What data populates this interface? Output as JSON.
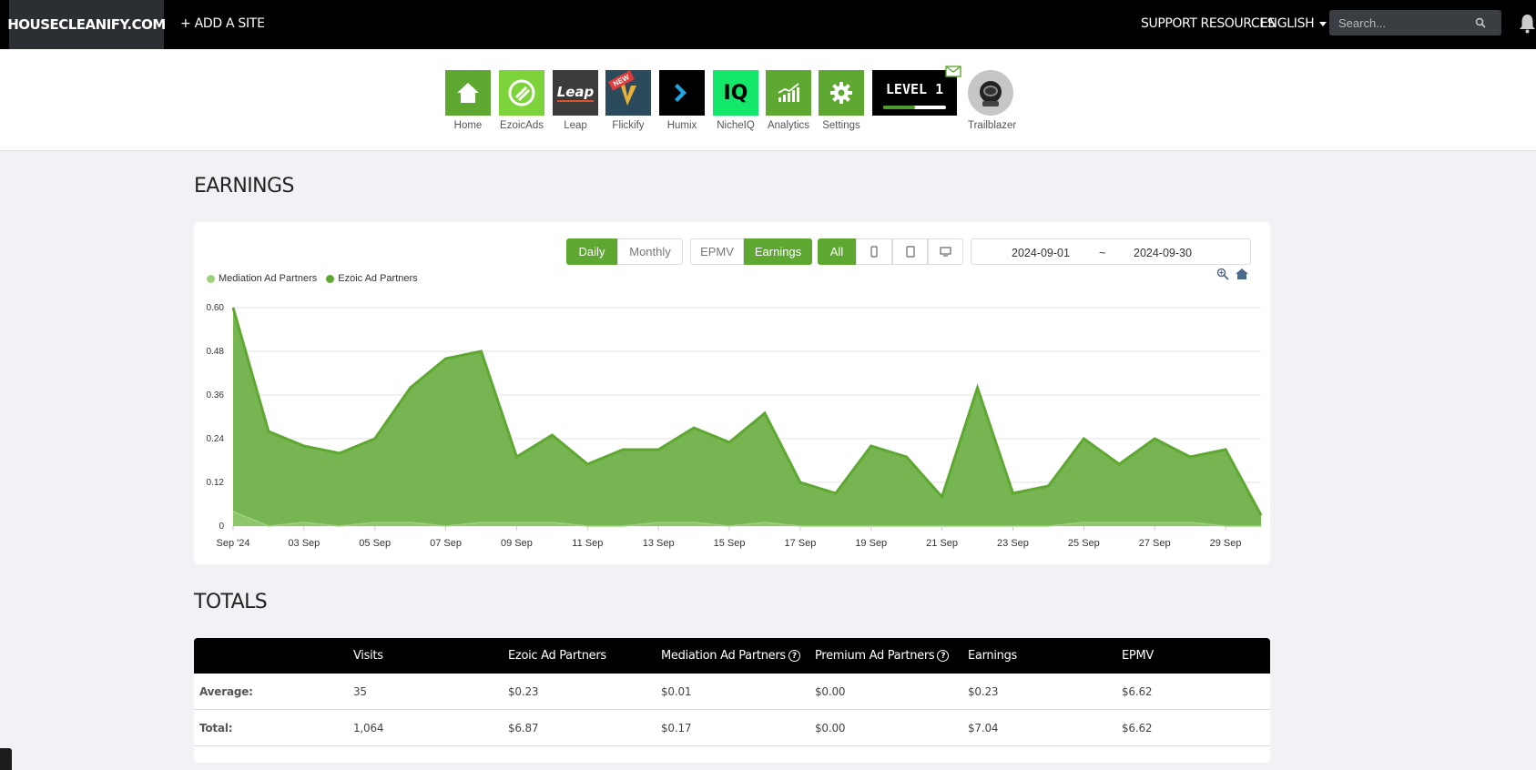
{
  "topbar": {
    "site_name": "HOUSECLEANIFY.COM",
    "add_site": "+ ADD A SITE",
    "support": "SUPPORT RESOURCES",
    "language": "ENGLISH",
    "search_placeholder": "Search..."
  },
  "apps": [
    {
      "label": "Home",
      "icon": "home-icon",
      "color": "#5ea832"
    },
    {
      "label": "EzoicAds",
      "icon": "ezoicads-icon",
      "color": "#7dd33a"
    },
    {
      "label": "Leap",
      "icon": "leap-logo",
      "color": "#3b3b3b"
    },
    {
      "label": "Flickify",
      "icon": "flickify-logo",
      "color": "#2b4a5c"
    },
    {
      "label": "Humix",
      "icon": "humix-logo",
      "color": "#000000"
    },
    {
      "label": "NicheIQ",
      "icon": "nicheiq-logo",
      "color": "#14e86a"
    },
    {
      "label": "Analytics",
      "icon": "analytics-icon",
      "color": "#5ea832"
    },
    {
      "label": "Settings",
      "icon": "gear-icon",
      "color": "#5ea832"
    }
  ],
  "app_badges": {
    "leap_text": "Leap",
    "flickify_new": "NEW",
    "nicheiq_text": "IQ"
  },
  "level": {
    "label": "LEVEL 1",
    "progress": 0.5
  },
  "trailblazer": {
    "label": "Trailblazer"
  },
  "earnings": {
    "title": "EARNINGS",
    "period_buttons": [
      "Daily",
      "Monthly"
    ],
    "metric_buttons": [
      "EPMV",
      "Earnings"
    ],
    "device_all": "All",
    "date_from": "2024-09-01",
    "date_sep": "~",
    "date_to": "2024-09-30",
    "legend": [
      "Mediation Ad Partners",
      "Ezoic Ad Partners"
    ]
  },
  "chart_data": {
    "type": "area",
    "x": [
      "2024-09-01",
      "2024-09-02",
      "2024-09-03",
      "2024-09-04",
      "2024-09-05",
      "2024-09-06",
      "2024-09-07",
      "2024-09-08",
      "2024-09-09",
      "2024-09-10",
      "2024-09-11",
      "2024-09-12",
      "2024-09-13",
      "2024-09-14",
      "2024-09-15",
      "2024-09-16",
      "2024-09-17",
      "2024-09-18",
      "2024-09-19",
      "2024-09-20",
      "2024-09-21",
      "2024-09-22",
      "2024-09-23",
      "2024-09-24",
      "2024-09-25",
      "2024-09-26",
      "2024-09-27",
      "2024-09-28",
      "2024-09-29",
      "2024-09-30"
    ],
    "x_tick_labels": [
      "Sep '24",
      "03 Sep",
      "05 Sep",
      "07 Sep",
      "09 Sep",
      "11 Sep",
      "13 Sep",
      "15 Sep",
      "17 Sep",
      "19 Sep",
      "21 Sep",
      "23 Sep",
      "25 Sep",
      "27 Sep",
      "29 Sep"
    ],
    "y_ticks": [
      "0",
      "0.12",
      "0.24",
      "0.36",
      "0.48",
      "0.60"
    ],
    "ylim": [
      0,
      0.6
    ],
    "series": [
      {
        "name": "Ezoic Ad Partners",
        "color": "#5ea832",
        "values": [
          0.6,
          0.26,
          0.22,
          0.2,
          0.24,
          0.38,
          0.46,
          0.48,
          0.19,
          0.25,
          0.17,
          0.21,
          0.21,
          0.27,
          0.23,
          0.31,
          0.12,
          0.09,
          0.22,
          0.19,
          0.08,
          0.38,
          0.09,
          0.11,
          0.24,
          0.17,
          0.24,
          0.19,
          0.21,
          0.03
        ]
      },
      {
        "name": "Mediation Ad Partners",
        "color": "#9fd27f",
        "values": [
          0.04,
          0.0,
          0.01,
          0.0,
          0.01,
          0.01,
          0.0,
          0.01,
          0.01,
          0.01,
          0.0,
          0.0,
          0.01,
          0.01,
          0.0,
          0.01,
          0.0,
          0.0,
          0.0,
          0.0,
          0.0,
          0.0,
          0.0,
          0.0,
          0.01,
          0.01,
          0.01,
          0.01,
          0.0,
          0.0
        ]
      }
    ],
    "grid": true,
    "legend_position": "top-left"
  },
  "totals": {
    "title": "TOTALS",
    "headers": [
      "Visits",
      "Ezoic Ad Partners",
      "Mediation Ad Partners",
      "Premium Ad Partners",
      "Earnings",
      "EPMV"
    ],
    "rows": [
      {
        "label": "Average:",
        "cells": [
          "35",
          "$0.23",
          "$0.01",
          "$0.00",
          "$0.23",
          "$6.62"
        ]
      },
      {
        "label": "Total:",
        "cells": [
          "1,064",
          "$6.87",
          "$0.17",
          "$0.00",
          "$7.04",
          "$6.62"
        ]
      }
    ]
  }
}
